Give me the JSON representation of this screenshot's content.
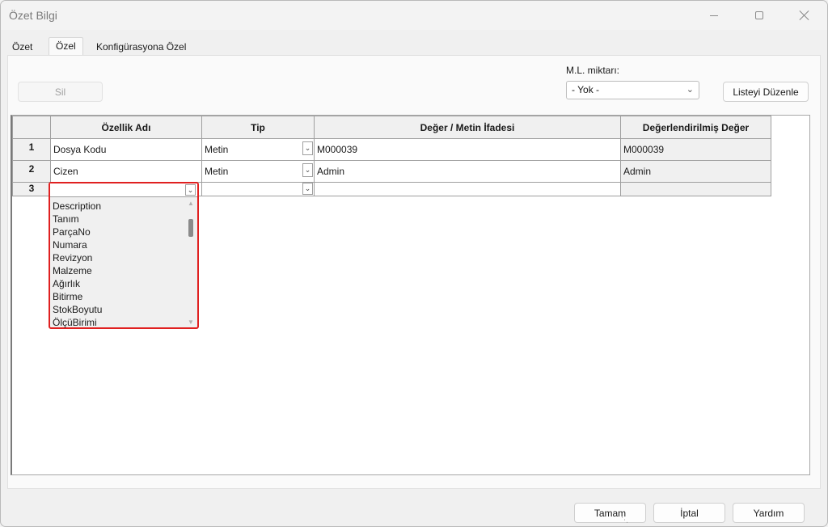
{
  "window": {
    "title": "Özet Bilgi"
  },
  "tabs": [
    {
      "label": "Özet",
      "active": false
    },
    {
      "label": "Özel",
      "active": true
    },
    {
      "label": "Konfigürasyona Özel",
      "active": false
    }
  ],
  "toolbar": {
    "delete_label": "Sil",
    "ml_label": "M.L. miktarı:",
    "ml_selected": "- Yok -",
    "edit_list_label": "Listeyi Düzenle"
  },
  "grid": {
    "columns": [
      "Özellik Adı",
      "Tip",
      "Değer / Metin İfadesi",
      "Değerlendirilmiş Değer"
    ],
    "rows": [
      {
        "num": "1",
        "name": "Dosya Kodu",
        "type": "Metin",
        "value": "M000039",
        "evaluated": "M000039"
      },
      {
        "num": "2",
        "name": "Cizen",
        "type": "Metin",
        "value": "Admin",
        "evaluated": "Admin"
      },
      {
        "num": "3",
        "name": "",
        "type": "",
        "value": "",
        "evaluated": ""
      }
    ]
  },
  "dropdown": {
    "items": [
      "Description",
      "Tanım",
      "ParçaNo",
      "Numara",
      "Revizyon",
      "Malzeme",
      "Ağırlık",
      "Bitirme",
      "StokBoyutu",
      "ÖlçüBirimi"
    ]
  },
  "footer": {
    "ok_label": "Tamam",
    "cancel_label": "İptal",
    "help_label": "Yardım"
  },
  "colors": {
    "highlight_border": "#e02020"
  }
}
